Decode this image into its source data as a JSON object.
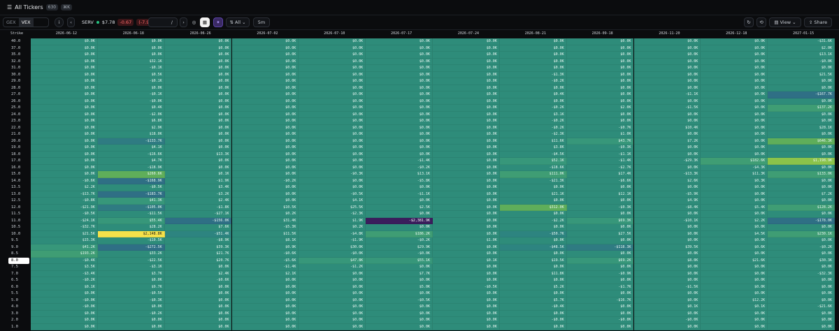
{
  "topbar": {
    "title": "All Tickers",
    "count": "630",
    "shortcut": "⌘K"
  },
  "toolbar": {
    "gex": "GEX",
    "vex": "VEX",
    "symbol": "SERV",
    "price": "$7.78",
    "change": "-0.67",
    "change_pct": "(-7.96%)",
    "date_placeholder": "/",
    "filter": "All",
    "interval": "5m",
    "view": "View",
    "share": "Share"
  },
  "columns": {
    "strike": "Strike",
    "expiries": [
      "2026-06-12",
      "2026-06-18",
      "2026-06-26",
      "2026-07-02",
      "2026-07-10",
      "2026-07-17",
      "2026-07-24",
      "2026-08-21",
      "2026-09-18",
      "2026-11-20",
      "2026-12-18",
      "2027-01-15"
    ]
  },
  "spot_strike": "8.0",
  "rows": [
    {
      "s": "40.0",
      "v": [
        "$0.0K",
        "$0.0K",
        "$0.0K",
        "$0.0K",
        "$0.0K",
        "$0.0K",
        "$0.0K",
        "$0.0K",
        "$0.0K",
        "$0.0K",
        "$0.0K",
        "-$31.6K"
      ]
    },
    {
      "s": "37.0",
      "v": [
        "$0.0K",
        "$0.0K",
        "$0.0K",
        "$0.0K",
        "$0.0K",
        "$0.0K",
        "$0.0K",
        "$0.0K",
        "$0.0K",
        "$0.0K",
        "$0.0K",
        "$2.0K"
      ]
    },
    {
      "s": "35.0",
      "v": [
        "$0.0K",
        "$0.0K",
        "$0.0K",
        "$0.0K",
        "$0.0K",
        "$0.0K",
        "$0.0K",
        "$0.0K",
        "$0.0K",
        "$0.0K",
        "$0.0K",
        "$13.1K"
      ]
    },
    {
      "s": "32.0",
      "v": [
        "$0.0K",
        "$32.1K",
        "$0.0K",
        "$0.0K",
        "$0.0K",
        "$0.0K",
        "$0.0K",
        "$0.0K",
        "$0.0K",
        "$0.0K",
        "$0.0K",
        "-$0.0K"
      ]
    },
    {
      "s": "31.0",
      "v": [
        "$0.0K",
        "-$0.1K",
        "$0.0K",
        "$0.0K",
        "$0.0K",
        "$0.0K",
        "$0.0K",
        "$0.0K",
        "$0.0K",
        "$0.0K",
        "$0.0K",
        "$0.0K"
      ]
    },
    {
      "s": "30.0",
      "v": [
        "$0.0K",
        "$0.5K",
        "$0.0K",
        "$0.0K",
        "$0.0K",
        "$0.0K",
        "$0.0K",
        "-$1.3K",
        "$0.0K",
        "$0.0K",
        "$0.0K",
        "$21.5K"
      ]
    },
    {
      "s": "29.0",
      "v": [
        "$0.0K",
        "-$0.1K",
        "$0.0K",
        "$0.0K",
        "$0.0K",
        "$0.0K",
        "$0.0K",
        "-$0.2K",
        "$0.0K",
        "$0.0K",
        "$0.0K",
        "$0.0K"
      ]
    },
    {
      "s": "28.0",
      "v": [
        "$0.0K",
        "$0.0K",
        "$0.0K",
        "$0.0K",
        "$0.0K",
        "$0.0K",
        "$0.0K",
        "$0.0K",
        "$0.0K",
        "$0.0K",
        "$0.0K",
        "$0.0K"
      ]
    },
    {
      "s": "27.0",
      "v": [
        "$0.0K",
        "-$0.1K",
        "$0.0K",
        "$0.0K",
        "$0.0K",
        "$0.0K",
        "$0.0K",
        "$0.4K",
        "$0.0K",
        "-$1.1K",
        "$0.0K",
        "-$167.7K"
      ]
    },
    {
      "s": "26.0",
      "v": [
        "$0.0K",
        "-$0.0K",
        "$0.0K",
        "$0.0K",
        "$0.0K",
        "$0.0K",
        "$0.0K",
        "$0.0K",
        "$0.0K",
        "$0.0K",
        "$0.0K",
        "$0.0K"
      ]
    },
    {
      "s": "25.0",
      "v": [
        "$0.0K",
        "$0.4K",
        "$0.0K",
        "$0.0K",
        "$0.0K",
        "$0.0K",
        "$0.0K",
        "-$0.2K",
        "$2.0K",
        "-$1.5K",
        "$0.0K",
        "$137.2K"
      ]
    },
    {
      "s": "24.0",
      "v": [
        "$0.0K",
        "-$2.0K",
        "$0.0K",
        "$0.0K",
        "$0.0K",
        "$0.0K",
        "$0.0K",
        "$3.1K",
        "$0.0K",
        "$0.0K",
        "$0.0K",
        "$0.0K"
      ]
    },
    {
      "s": "23.0",
      "v": [
        "$0.0K",
        "$6.8K",
        "$0.0K",
        "$0.0K",
        "$0.0K",
        "$0.0K",
        "$0.0K",
        "-$0.2K",
        "$0.0K",
        "$0.0K",
        "$0.0K",
        "$0.0K"
      ]
    },
    {
      "s": "22.0",
      "v": [
        "$0.0K",
        "$2.9K",
        "$0.0K",
        "$0.0K",
        "$0.0K",
        "$0.0K",
        "$0.0K",
        "-$0.2K",
        "-$0.7K",
        "$10.4K",
        "$0.0K",
        "$28.1K"
      ]
    },
    {
      "s": "21.0",
      "v": [
        "$0.0K",
        "$18.0K",
        "$0.0K",
        "$0.0K",
        "$0.0K",
        "$0.0K",
        "$0.0K",
        "-$2.3K",
        "$1.0K",
        "$0.0K",
        "$0.0K",
        "$0.0K"
      ]
    },
    {
      "s": "20.0",
      "v": [
        "$0.0K",
        "-$133.7K",
        "$0.0K",
        "$0.0K",
        "$0.0K",
        "$0.0K",
        "$0.0K",
        "$11.6K",
        "$43.7K",
        "$7.2K",
        "$0.0K",
        "$646.3K"
      ]
    },
    {
      "s": "19.0",
      "v": [
        "$0.0K",
        "$4.1K",
        "$0.0K",
        "$0.0K",
        "$0.0K",
        "$0.0K",
        "$0.0K",
        "$3.8K",
        "-$0.3K",
        "$0.0K",
        "$0.0K",
        "$0.0K"
      ]
    },
    {
      "s": "18.0",
      "v": [
        "$0.0K",
        "-$16.6K",
        "$13.3K",
        "$0.0K",
        "$0.0K",
        "$0.0K",
        "$0.0K",
        "-$4.5K",
        "-$1.1K",
        "$0.0K",
        "$0.0K",
        "$0.0K"
      ]
    },
    {
      "s": "17.0",
      "v": [
        "$0.0K",
        "$4.7K",
        "$0.0K",
        "$0.0K",
        "$0.0K",
        "-$1.4K",
        "$0.0K",
        "$52.1K",
        "-$1.4K",
        "-$29.3K",
        "$182.6K",
        "$1,198.9K"
      ]
    },
    {
      "s": "16.0",
      "v": [
        "$0.0K",
        "-$18.9K",
        "$0.0K",
        "$0.0K",
        "$0.0K",
        "-$0.2K",
        "$0.0K",
        "-$18.6K",
        "-$2.7K",
        "$0.0K",
        "-$4.3K",
        "$0.0K"
      ]
    },
    {
      "s": "15.0",
      "v": [
        "$0.0K",
        "$260.6K",
        "$0.1K",
        "$0.0K",
        "-$0.3K",
        "$13.1K",
        "$0.0K",
        "$111.0K",
        "$17.4K",
        "-$13.3K",
        "$11.3K",
        "$133.0K"
      ]
    },
    {
      "s": "14.0",
      "v": [
        "-$0.6K",
        "-$168.9K",
        "-$1.9K",
        "-$0.2K",
        "$0.0K",
        "-$5.8K",
        "$0.0K",
        "-$21.3K",
        "-$6.6K",
        "$2.6K",
        "$0.3K",
        "$0.0K"
      ]
    },
    {
      "s": "13.5",
      "v": [
        "$2.2K",
        "-$0.5K",
        "$3.4K",
        "$0.0K",
        "$0.0K",
        "$0.0K",
        "$0.0K",
        "$0.0K",
        "$0.0K",
        "$0.0K",
        "$0.0K",
        "$0.0K"
      ]
    },
    {
      "s": "13.0",
      "v": [
        "-$13.7K",
        "-$183.7K",
        "-$3.2K",
        "$0.0K",
        "-$0.5K",
        "-$1.1K",
        "$0.0K",
        "$21.1K",
        "$12.1K",
        "-$5.9K",
        "$0.0K",
        "$7.2K"
      ]
    },
    {
      "s": "12.5",
      "v": [
        "-$0.8K",
        "$41.3K",
        "$2.4K",
        "$0.0K",
        "$4.1K",
        "$0.0K",
        "$0.0K",
        "$0.0K",
        "$0.0K",
        "$4.9K",
        "$0.0K",
        "$0.0K"
      ]
    },
    {
      "s": "12.0",
      "v": [
        "-$21.9K",
        "-$105.0K",
        "-$1.8K",
        "$10.5K",
        "$25.5K",
        "$2.5K",
        "$0.0K",
        "$312.0K",
        "-$0.3K",
        "-$8.4K",
        "$5.4K",
        "$128.2K"
      ]
    },
    {
      "s": "11.5",
      "v": [
        "-$0.5K",
        "-$11.5K",
        "-$27.1K",
        "$0.2K",
        "-$2.3K",
        "$0.0K",
        "$0.0K",
        "$0.0K",
        "$0.0K",
        "$0.0K",
        "$0.0K",
        "$0.0K"
      ]
    },
    {
      "s": "11.0",
      "v": [
        "-$24.1K",
        "$55.4K",
        "-$156.0K",
        "$31.4K",
        "$1.9K",
        "-$2,381.9K",
        "$0.0K",
        "-$2.2K",
        "$69.3K",
        "-$10.1K",
        "$2.2K",
        "-$178.0K"
      ]
    },
    {
      "s": "10.5",
      "v": [
        "-$32.7K",
        "$28.2K",
        "$7.6K",
        "-$5.3K",
        "$0.2K",
        "$0.0K",
        "$0.0K",
        "$0.0K",
        "$0.0K",
        "$0.0K",
        "$0.0K",
        "$0.0K"
      ]
    },
    {
      "s": "10.0",
      "v": [
        "$21.5K",
        "$2,148.8K",
        "-$51.4K",
        "$11.5K",
        "-$4.8K",
        "$186.2K",
        "$0.0K",
        "-$50.7K",
        "$27.5K",
        "$0.0K",
        "$4.5K",
        "$230.1K"
      ]
    },
    {
      "s": "9.5",
      "v": [
        "$15.3K",
        "-$10.5K",
        "-$8.9K",
        "$8.1K",
        "-$1.9K",
        "-$0.2K",
        "$1.0K",
        "$0.0K",
        "$0.0K",
        "$0.0K",
        "$0.0K",
        "$0.0K"
      ]
    },
    {
      "s": "9.0",
      "v": [
        "$41.2K",
        "-$272.5K",
        "$39.3K",
        "$0.9K",
        "$30.0K",
        "$29.9K",
        "$0.0K",
        "-$48.5K",
        "-$118.3K",
        "$39.5K",
        "$0.6K",
        "-$0.2K"
      ]
    },
    {
      "s": "8.5",
      "v": [
        "$193.2K",
        "$33.2K",
        "$21.7K",
        "-$0.6K",
        "-$0.0K",
        "-$0.0K",
        "$0.0K",
        "$0.0K",
        "$0.0K",
        "$0.0K",
        "$0.0K",
        "$0.0K"
      ]
    },
    {
      "s": "8.0",
      "v": [
        "-$0.4K",
        "-$22.5K",
        "$20.7K",
        "-$5.6K",
        "$47.8K",
        "$55.1K",
        "$0.1K",
        "$19.5K",
        "$69.2K",
        "$8.0K",
        "$21.6K",
        "$30.3K"
      ]
    },
    {
      "s": "7.5",
      "v": [
        "$3.5K",
        "-$3.1K",
        "$0.0K",
        "-$1.4K",
        "-$1.2K",
        "$0.0K",
        "$0.0K",
        "$0.0K",
        "$0.0K",
        "$0.0K",
        "$0.0K",
        "$0.0K"
      ]
    },
    {
      "s": "7.0",
      "v": [
        "-$3.4K",
        "$3.7K",
        "$2.4K",
        "$2.1K",
        "$0.0K",
        "$7.7K",
        "$0.0K",
        "$11.8K",
        "-$0.9K",
        "$0.0K",
        "$0.0K",
        "-$32.3K"
      ]
    },
    {
      "s": "6.5",
      "v": [
        "-$0.2K",
        "$0.0K",
        "-$0.6K",
        "$0.0K",
        "$0.0K",
        "$0.0K",
        "$0.0K",
        "$0.0K",
        "$0.0K",
        "$0.0K",
        "$0.0K",
        "$0.0K"
      ]
    },
    {
      "s": "6.0",
      "v": [
        "$0.1K",
        "$9.7K",
        "$0.0K",
        "$0.0K",
        "$0.0K",
        "$5.0K",
        "-$0.5K",
        "$5.2K",
        "-$1.7K",
        "-$1.5K",
        "$0.0K",
        "$0.0K"
      ]
    },
    {
      "s": "5.5",
      "v": [
        "$0.0K",
        "-$0.5K",
        "$0.0K",
        "$0.0K",
        "$0.0K",
        "$0.0K",
        "$0.0K",
        "$0.0K",
        "$0.0K",
        "$0.0K",
        "$0.0K",
        "$0.0K"
      ]
    },
    {
      "s": "5.0",
      "v": [
        "-$0.0K",
        "-$0.3K",
        "$0.0K",
        "$0.0K",
        "$0.0K",
        "-$0.5K",
        "$0.0K",
        "$5.7K",
        "-$16.7K",
        "$0.0K",
        "$12.2K",
        "$0.0K"
      ]
    },
    {
      "s": "4.0",
      "v": [
        "-$0.0K",
        "$0.0K",
        "$0.0K",
        "$0.0K",
        "$0.0K",
        "$0.0K",
        "$0.0K",
        "-$0.4K",
        "$0.0K",
        "$0.1K",
        "$0.1K",
        "-$21.6K"
      ]
    },
    {
      "s": "3.0",
      "v": [
        "$0.0K",
        "-$0.2K",
        "$0.0K",
        "$0.0K",
        "$0.0K",
        "$0.0K",
        "$0.0K",
        "$0.0K",
        "$0.0K",
        "$0.0K",
        "$0.0K",
        "$0.0K"
      ]
    },
    {
      "s": "2.0",
      "v": [
        "$0.0K",
        "$0.0K",
        "$0.0K",
        "$0.0K",
        "$0.0K",
        "$0.0K",
        "$0.0K",
        "-$0.0K",
        "-$0.0K",
        "-$0.0K",
        "$0.0K",
        "$0.0K"
      ]
    },
    {
      "s": "1.0",
      "v": [
        "$0.0K",
        "$0.0K",
        "$0.0K",
        "$0.0K",
        "$0.0K",
        "$0.0K",
        "$0.0K",
        "$0.0K",
        "$0.0K",
        "$0.0K",
        "$0.0K",
        "$0.0K"
      ]
    }
  ],
  "highlights": {
    "max_positive": "$2,148.8K",
    "max_negative": "-$2,381.9K"
  },
  "colors": {
    "base": "#2e8c7a",
    "max": "#f5e14a",
    "min": "#3a1e5c",
    "green_light": "#8bc34a",
    "green_mid": "#5fae5a",
    "blue_dim": "#2f6f85"
  }
}
